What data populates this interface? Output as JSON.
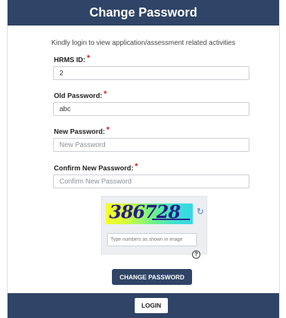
{
  "header": {
    "title": "Change Password"
  },
  "subtitle": "Kindly login to view application/assessment related activities",
  "form": {
    "hrms_label": "HRMS ID:",
    "hrms_value": "2",
    "old_label": "Old Password:",
    "old_value": "abc",
    "new_label": "New Password:",
    "new_placeholder": "New Password",
    "confirm_label": "Confirm New Password:",
    "confirm_placeholder": "Confirm New Password",
    "required_mark": "*"
  },
  "captcha": {
    "code": "386728",
    "input_placeholder": "Type numbers as shown in image",
    "refresh_icon": "refresh-icon",
    "help_icon": "question-circle-icon",
    "help_glyph": "?"
  },
  "buttons": {
    "change_password": "CHANGE PASSWORD",
    "login": "LOGIN"
  },
  "colors": {
    "primary": "#2f4466",
    "required": "#e02020"
  }
}
